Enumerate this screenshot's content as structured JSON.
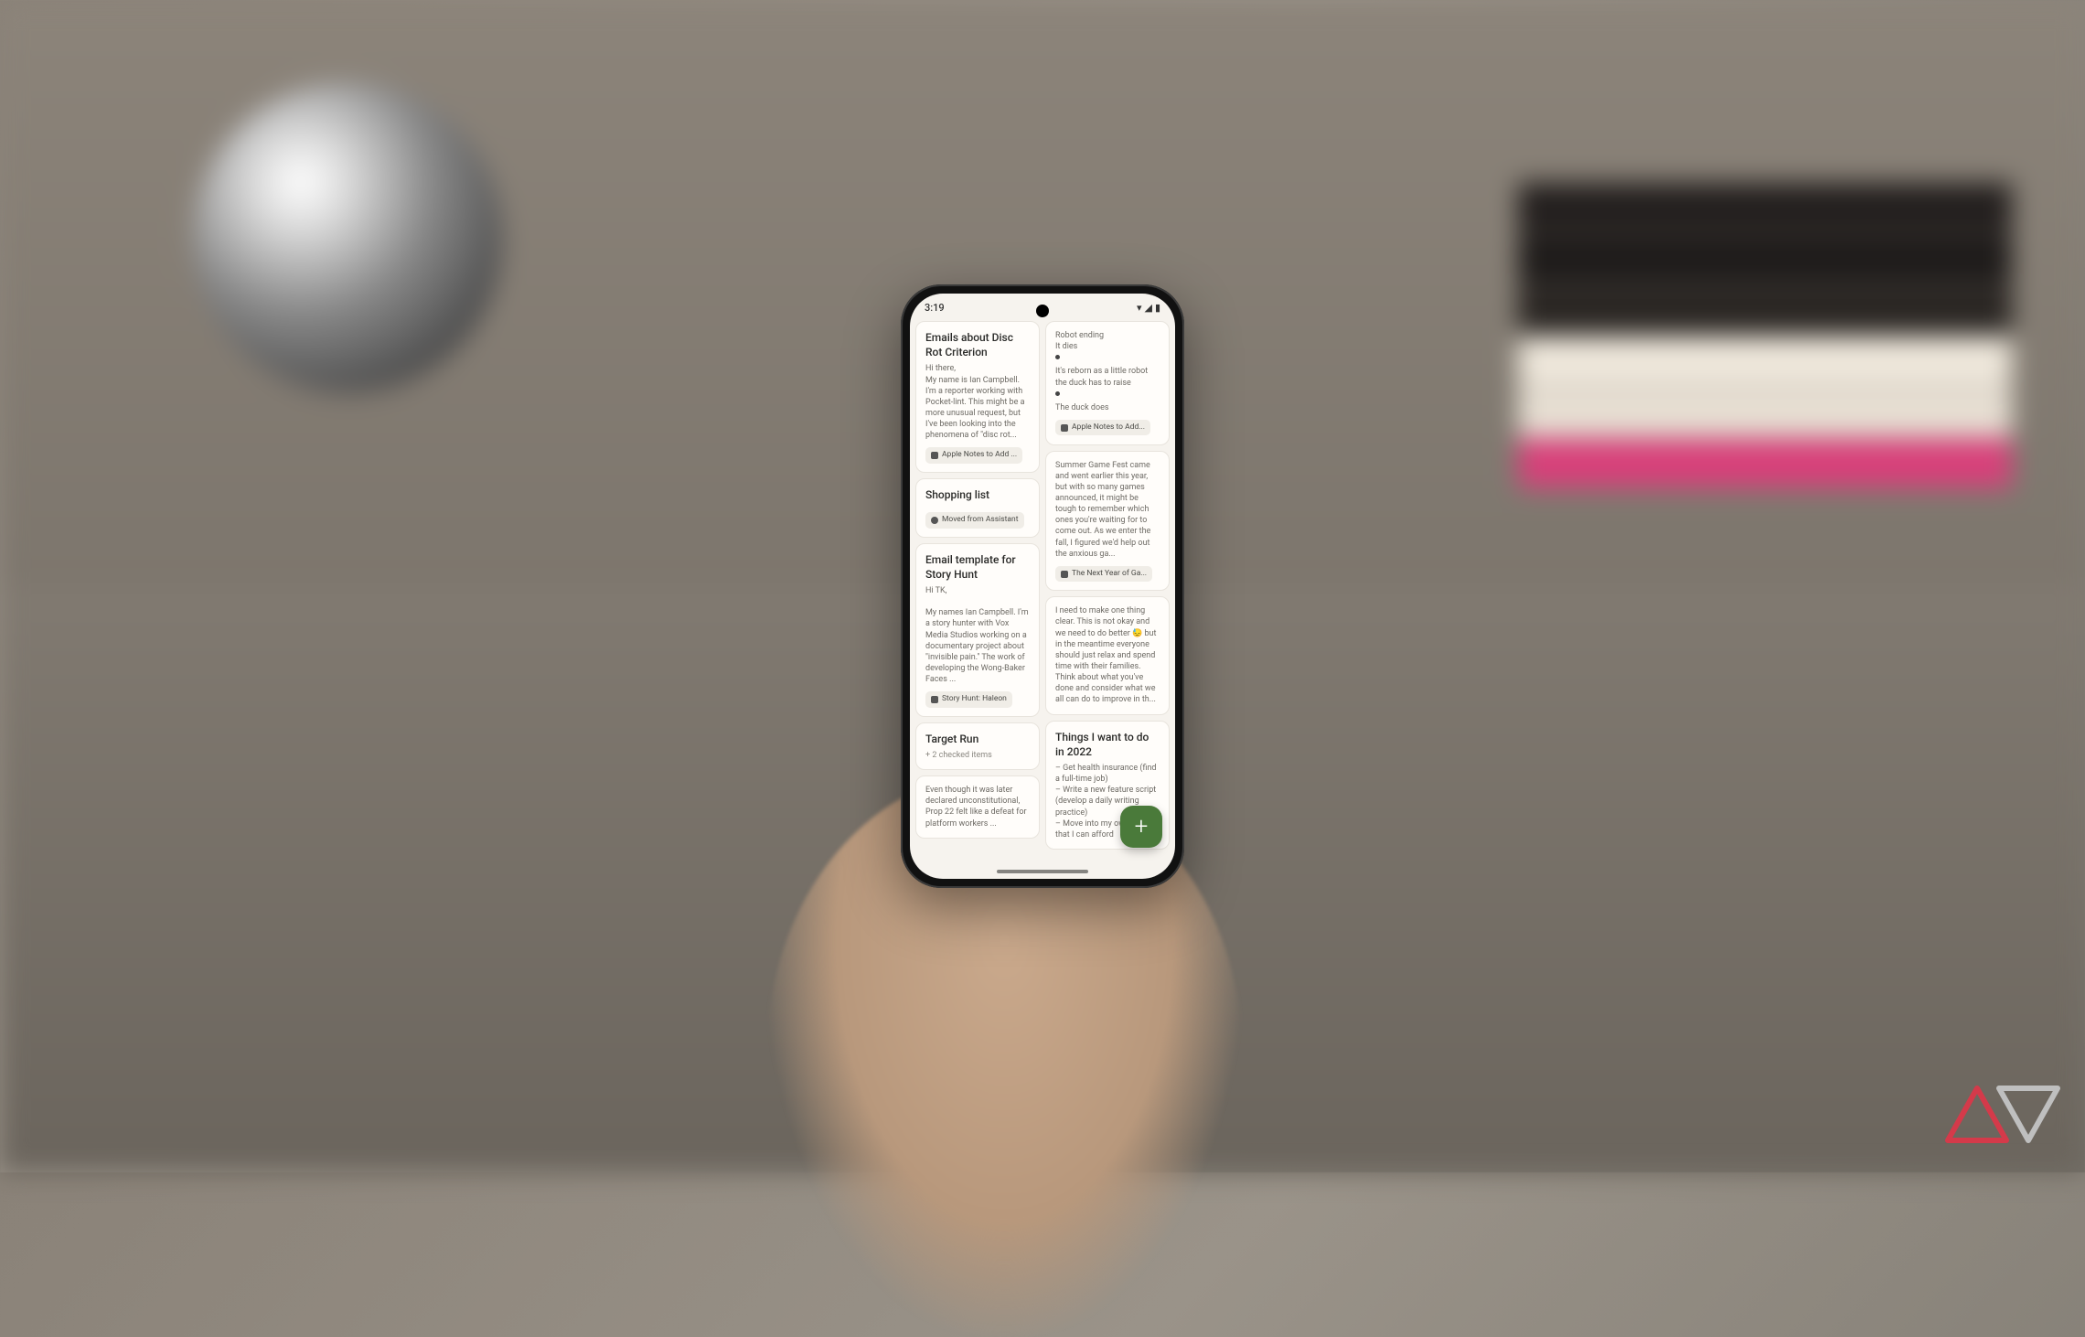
{
  "statusbar": {
    "time": "3:19"
  },
  "fab": {
    "glyph": "+"
  },
  "left": [
    {
      "title": "Emails about Disc Rot Criterion",
      "body": "Hi there,\nMy name is Ian Campbell. I'm a reporter working with Pocket-lint. This might be a more unusual request, but I've been looking into the phenomena of \"disc rot...",
      "tag": "Apple Notes to Add ..."
    },
    {
      "title": "Shopping list",
      "body": "",
      "tag": "Moved from Assistant"
    },
    {
      "title": "Email template for Story Hunt",
      "body": "Hi TK,\n\nMy names Ian Campbell. I'm a story hunter with Vox Media Studios working on a documentary project about \"invisible pain.\" The work of developing the Wong-Baker Faces ...",
      "tag": "Story Hunt: Haleon"
    },
    {
      "title": "Target Run",
      "body": "",
      "checked": "+ 2 checked items"
    },
    {
      "title": "",
      "body": "Even though it was later declared unconstitutional, Prop 22 felt like a defeat for platform workers ..."
    }
  ],
  "right": [
    {
      "title": "",
      "lines": [
        "Robot ending",
        "It dies",
        "•",
        "It's reborn as a little robot the duck has to raise",
        "•",
        "The duck does"
      ],
      "tag": "Apple Notes to Add..."
    },
    {
      "title": "",
      "body": "Summer Game Fest came and went earlier this year, but with so many games announced, it might be tough to remember which ones you're waiting for to come out. As we enter the fall, I figured we'd help out the anxious ga...",
      "tag": "The Next Year of Ga..."
    },
    {
      "title": "",
      "body": "I need to make one thing clear. This is not okay and we need to do better 😓 but in the meantime everyone should just relax and spend time with their families. Think about what you've done and consider what we all can do to improve in th..."
    },
    {
      "title": "Things I want to do in 2022",
      "body": "– Get health insurance (find a full-time job)\n– Write a new feature script (develop a daily writing practice)\n– Move into my own place that I can afford"
    }
  ]
}
